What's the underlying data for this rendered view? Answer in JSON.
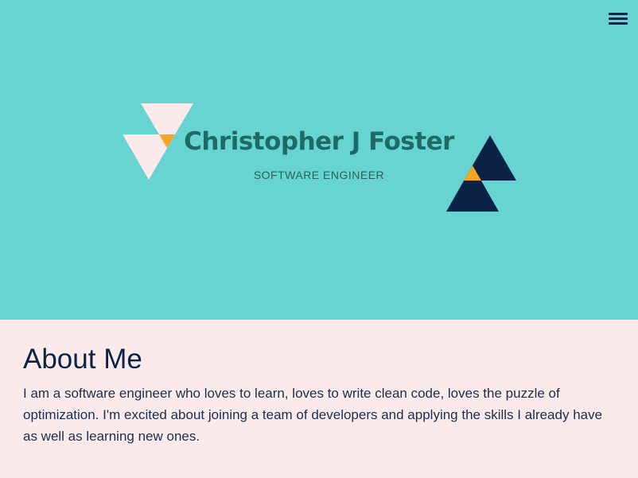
{
  "header": {
    "menu_icon": "hamburger-menu-icon",
    "name": "Christopher J Foster",
    "role": "SOFTWARE ENGINEER"
  },
  "colors": {
    "hero_bg": "#67d4d1",
    "about_bg": "#fbeaea",
    "navy": "#0b2347",
    "accent": "#f5a623",
    "light_triangle": "#fbeaea",
    "name_text": "#1c6b68"
  },
  "about": {
    "title": "About Me",
    "text": "I am a software engineer who loves to learn, loves to write clean code, loves the puzzle of optimization. I'm excited about joining a team of developers and applying the skills I already have as well as learning new ones."
  }
}
